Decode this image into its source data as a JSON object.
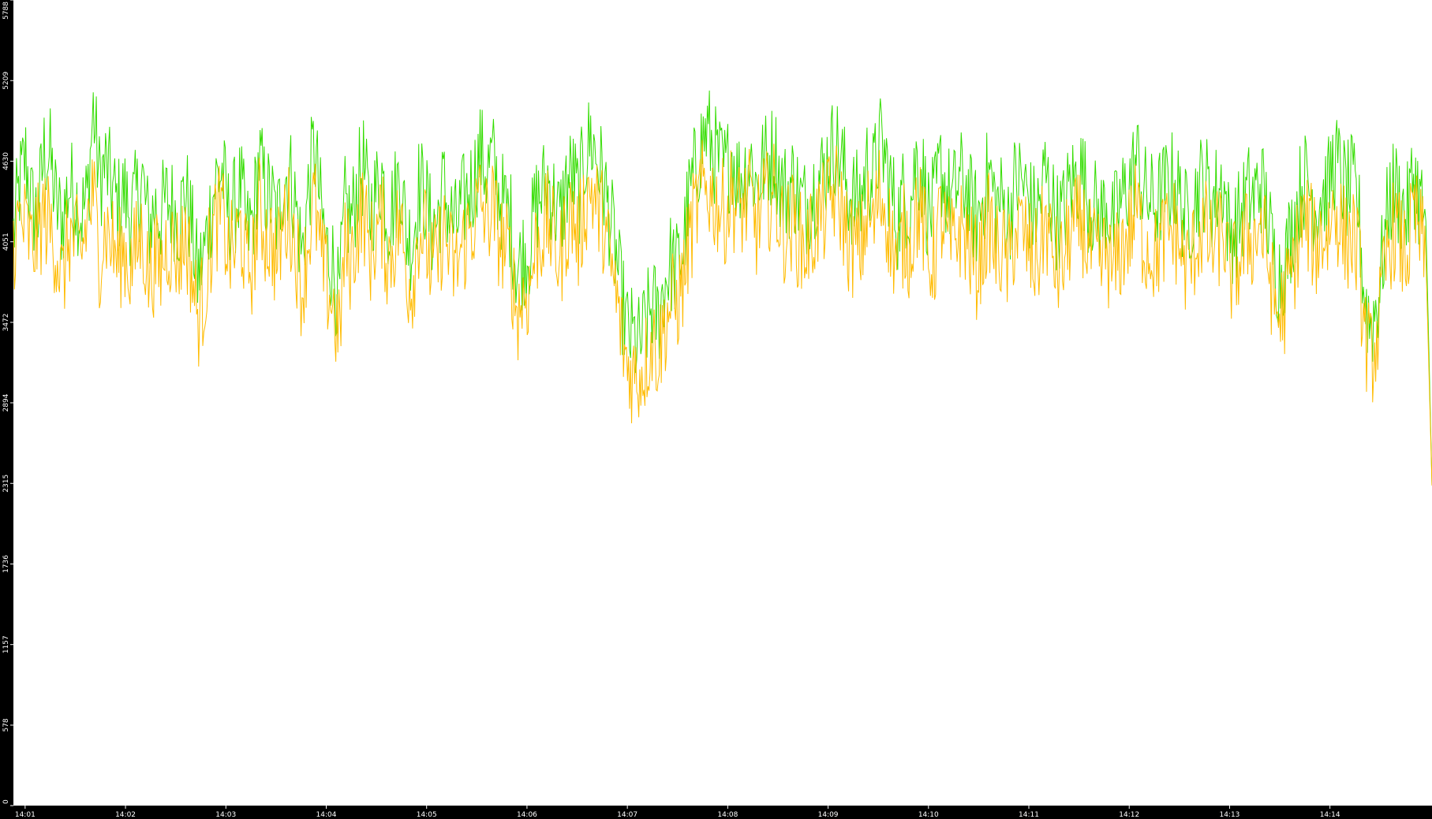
{
  "chart_data": {
    "type": "line",
    "title": "",
    "xlabel": "",
    "ylabel": "",
    "ylim": [
      0,
      5788
    ],
    "y_ticks": [
      "0",
      "578",
      "1157",
      "1736",
      "2315",
      "2894",
      "3472",
      "4051",
      "4630",
      "5209",
      "5788"
    ],
    "x_ticks": [
      "14:01",
      "14:02",
      "14:03",
      "14:04",
      "14:05",
      "14:06",
      "14:07",
      "14:08",
      "14:09",
      "14:10",
      "14:11",
      "14:12",
      "14:13",
      "14:14"
    ],
    "x_range": [
      "14:00:53",
      "14:15:01"
    ],
    "grid": false,
    "legend": "none",
    "background": "#ffffff",
    "frame_color": "#000000",
    "series": [
      {
        "color": "#33dd00",
        "values": [
          4100,
          4450,
          4650,
          4300,
          4250,
          4700,
          4650,
          4300,
          4200,
          4450,
          4400,
          4250,
          4350,
          5000,
          4500,
          4600,
          4450,
          4300,
          4400,
          4250,
          4350,
          4500,
          4150,
          4300,
          4250,
          4350,
          4300,
          4200,
          4450,
          4150,
          3800,
          3950,
          4250,
          4500,
          4550,
          4250,
          4300,
          4450,
          4100,
          4200,
          4650,
          4400,
          4350,
          4200,
          4500,
          4550,
          4300,
          3950,
          4400,
          4750,
          4300,
          4000,
          3900,
          3600,
          4300,
          4200,
          4450,
          4600,
          4250,
          4400,
          4550,
          4200,
          4350,
          4550,
          4100,
          4050,
          4450,
          4400,
          4150,
          4200,
          4450,
          4250,
          4150,
          4300,
          4400,
          4500,
          4700,
          4550,
          4650,
          4400,
          4300,
          4200,
          3850,
          3950,
          4000,
          4300,
          4400,
          4500,
          4350,
          4200,
          4450,
          4550,
          4350,
          4650,
          4800,
          4650,
          4500,
          4250,
          4000,
          3650,
          3400,
          3350,
          3300,
          3450,
          3600,
          3500,
          3750,
          3900,
          3850,
          4000,
          4350,
          4550,
          4750,
          4850,
          4700,
          4600,
          4550,
          4700,
          4500,
          4550,
          4650,
          4450,
          4600,
          4650,
          4700,
          4450,
          4400,
          4500,
          4350,
          4300,
          4400,
          4500,
          4550,
          4700,
          4750,
          4600,
          4400,
          4350,
          4350,
          4600,
          4500,
          4750,
          4650,
          4400,
          4200,
          4400,
          4300,
          4650,
          4550,
          4250,
          4300,
          4600,
          4400,
          4350,
          4500,
          4450,
          4300,
          4200,
          4400,
          4550,
          4300,
          4350,
          4200,
          4450,
          4500,
          4400,
          4250,
          4300,
          4550,
          4350,
          4200,
          4250,
          4450,
          4500,
          4550,
          4350,
          4300,
          4200,
          4350,
          4150,
          4300,
          4400,
          4500,
          4650,
          4400,
          4350,
          4300,
          4400,
          4450,
          4500,
          4350,
          4200,
          4300,
          4450,
          4500,
          4350,
          4400,
          4500,
          4100,
          4150,
          4250,
          4400,
          4350,
          4500,
          4300,
          4000,
          3800,
          3900,
          4100,
          4300,
          4500,
          4450,
          4300,
          4400,
          4400,
          4650,
          4550,
          4400,
          4450,
          4300,
          3650,
          3450,
          3600,
          3950,
          4350,
          4450,
          4300,
          4250,
          4550,
          4350,
          4200,
          2300
        ]
      },
      {
        "color": "#ffbb00",
        "values": [
          4050,
          4200,
          4150,
          4000,
          4100,
          4250,
          4150,
          4000,
          3750,
          4100,
          4050,
          3950,
          4200,
          4400,
          3950,
          4150,
          4050,
          3900,
          4000,
          3850,
          4000,
          4100,
          3800,
          3900,
          3850,
          4050,
          4000,
          3950,
          4100,
          3850,
          3500,
          3650,
          4000,
          4200,
          4250,
          3950,
          4000,
          4150,
          3850,
          3900,
          4300,
          4100,
          4050,
          3900,
          4200,
          4250,
          4000,
          3700,
          4050,
          4350,
          3950,
          3750,
          3600,
          3350,
          4000,
          3900,
          4150,
          4300,
          3950,
          4100,
          4200,
          3900,
          4050,
          4200,
          3800,
          3750,
          4150,
          4100,
          3850,
          3900,
          4150,
          3950,
          3850,
          4000,
          4100,
          4200,
          4350,
          4200,
          4300,
          4100,
          4000,
          3900,
          3550,
          3650,
          3700,
          4000,
          4100,
          4200,
          4050,
          3900,
          4150,
          4250,
          4050,
          4300,
          4450,
          4300,
          4200,
          3950,
          3700,
          3400,
          3150,
          3100,
          3100,
          3200,
          3350,
          3250,
          3450,
          3600,
          3600,
          3750,
          4050,
          4250,
          4400,
          4450,
          4350,
          4300,
          4250,
          4400,
          4250,
          4300,
          4350,
          4150,
          4300,
          4350,
          4400,
          4150,
          4100,
          4200,
          4050,
          4000,
          4100,
          4200,
          4250,
          4350,
          4400,
          4250,
          4050,
          4000,
          4000,
          4250,
          4150,
          4400,
          4300,
          4050,
          3900,
          4100,
          4000,
          4300,
          4200,
          3900,
          3950,
          4250,
          4050,
          4000,
          4150,
          4100,
          3950,
          3850,
          4050,
          4200,
          3950,
          4000,
          3850,
          4100,
          4150,
          4050,
          3900,
          3950,
          4200,
          4000,
          3850,
          3900,
          4100,
          4150,
          4200,
          4000,
          3950,
          3850,
          4000,
          3800,
          3950,
          4050,
          4150,
          4300,
          4050,
          4000,
          3950,
          4050,
          4100,
          4150,
          4000,
          3850,
          3950,
          4100,
          4150,
          4000,
          4050,
          4150,
          3800,
          3850,
          3950,
          4100,
          4050,
          4200,
          4000,
          3700,
          3500,
          3600,
          3800,
          4000,
          4200,
          4150,
          4000,
          4100,
          4100,
          4300,
          4200,
          4050,
          4100,
          3950,
          3400,
          3200,
          3350,
          3700,
          4050,
          4150,
          4000,
          3950,
          4250,
          4100,
          3950,
          2300
        ]
      }
    ]
  }
}
